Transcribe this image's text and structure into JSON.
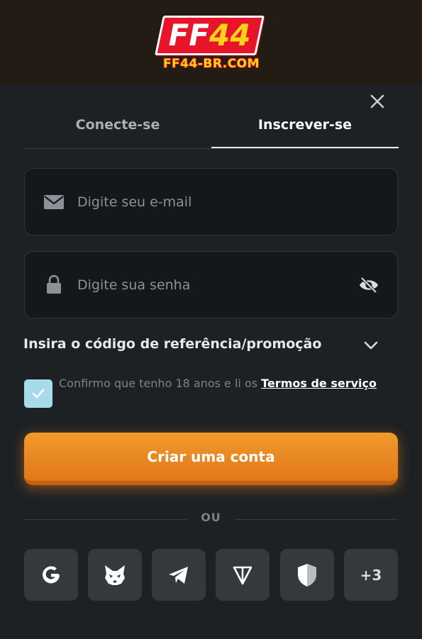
{
  "brand": {
    "logo_main": "FF",
    "logo_highlight": "44",
    "domain": "FF44-BR.COM"
  },
  "tabs": [
    {
      "label": "Conecte-se",
      "active": false
    },
    {
      "label": "Inscrever-se",
      "active": true
    }
  ],
  "form": {
    "email_placeholder": "Digite seu e-mail",
    "password_placeholder": "Digite sua senha",
    "promo_label": "Insira o código de referência/promoção",
    "terms_text": "Confirmo que tenho 18 anos e li os ",
    "terms_link": "Termos de serviço",
    "terms_checked": true,
    "submit_label": "Criar uma conta"
  },
  "divider_label": "OU",
  "social": {
    "items": [
      "google",
      "metamask",
      "telegram",
      "ton",
      "shield"
    ],
    "more_label": "+3"
  },
  "colors": {
    "background": "#1d2124",
    "header": "#221c15",
    "accent": "#f0902a",
    "checkbox": "#a6dbe9",
    "logo_red": "#e8142a",
    "logo_yellow": "#ffd21a"
  },
  "icons": {
    "close": "close-icon",
    "email": "envelope-icon",
    "password": "lock-icon",
    "visibility": "eye-off-icon",
    "promo": "chevron-down-icon",
    "check": "checkmark-icon"
  }
}
